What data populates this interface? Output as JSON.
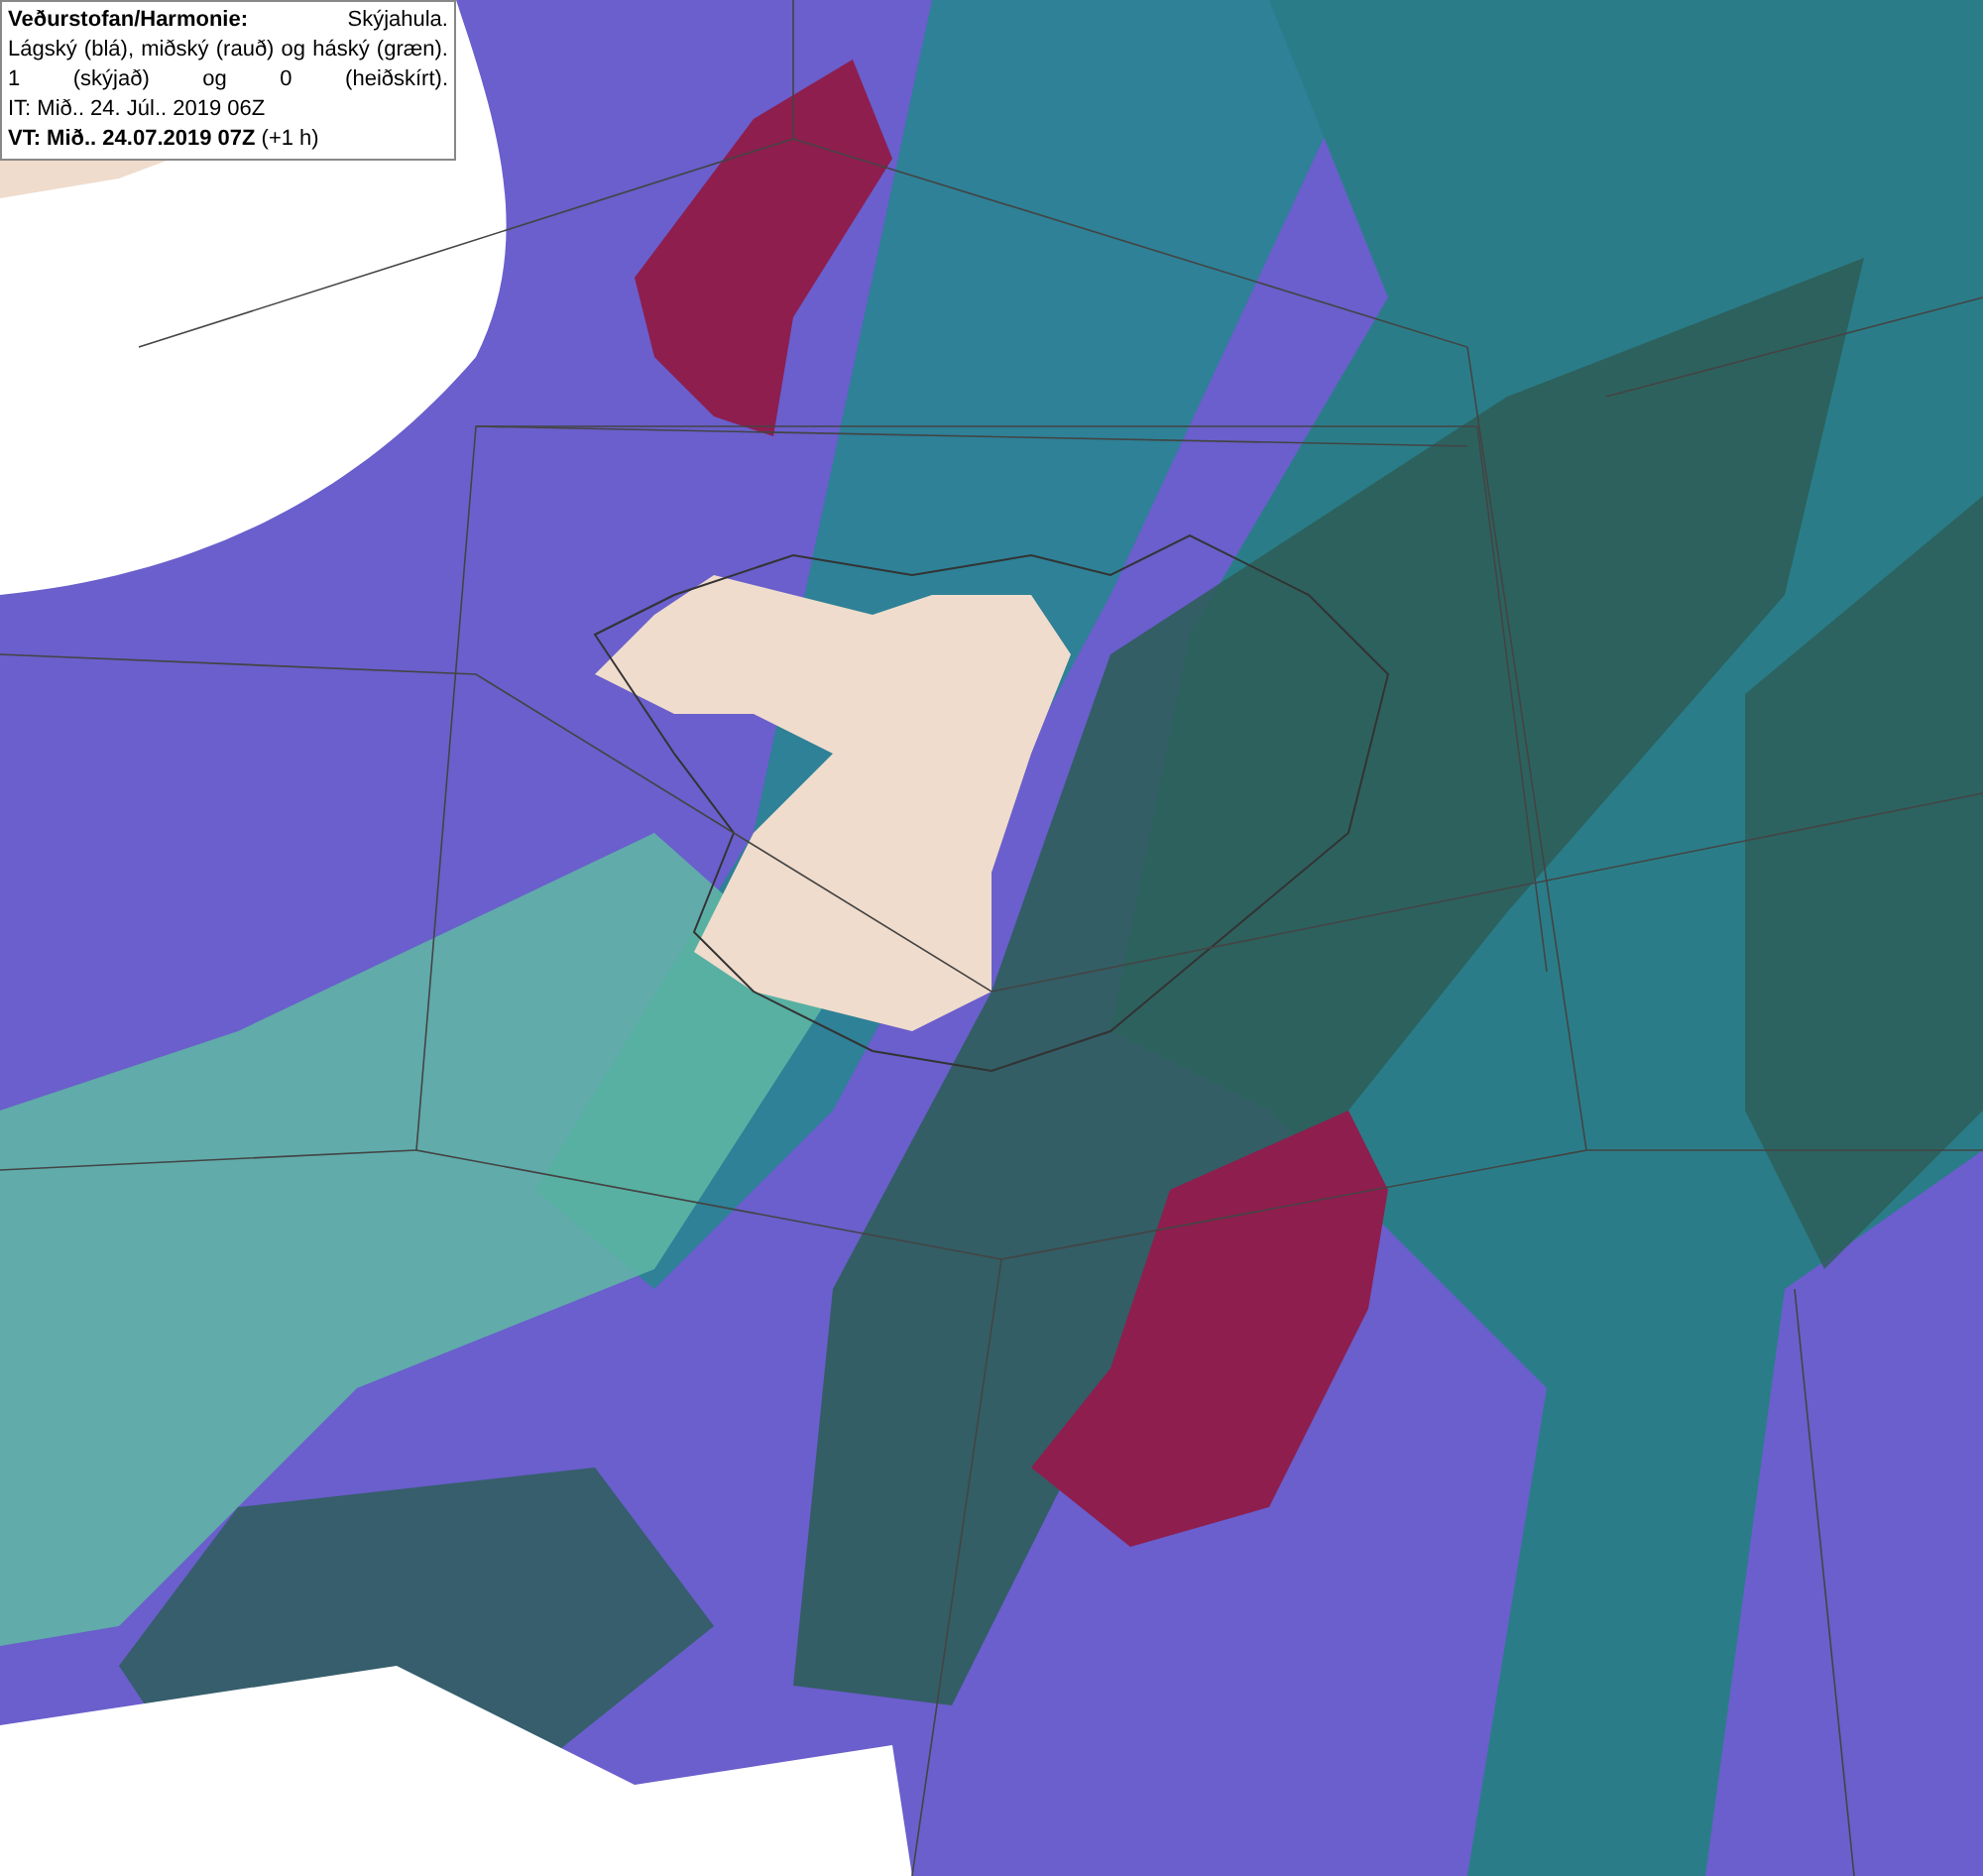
{
  "legend": {
    "title": "Veðurstofan/Harmonie:",
    "description_lines": [
      "Skýjahula.",
      "Lágský (blá), miðský (rauð) og háský (græn).",
      "1 (skýjað) og 0 (heiðskírt)."
    ],
    "issue_time": "IT: Mið.. 24. Júl.. 2019 06Z",
    "valid_time": "**VT: Mið.. 24.07.2019 07Z** (+1 h)"
  }
}
